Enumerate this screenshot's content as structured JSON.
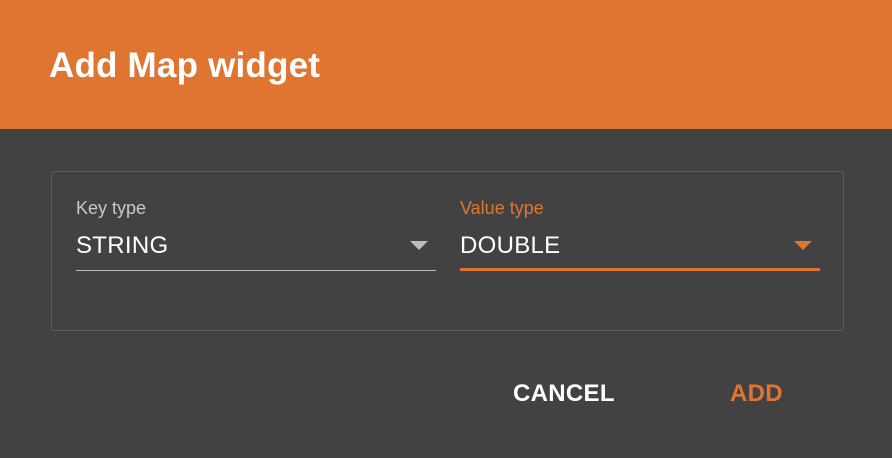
{
  "dialog": {
    "title": "Add Map widget",
    "header_color": "#e07532",
    "background_color": "#424242"
  },
  "fields": {
    "key_type": {
      "label": "Key type",
      "value": "STRING",
      "icon": "chevron-down-icon"
    },
    "value_type": {
      "label": "Value type",
      "value": "DOUBLE",
      "icon": "chevron-down-icon",
      "focused": true
    }
  },
  "actions": {
    "cancel_label": "CANCEL",
    "add_label": "ADD"
  },
  "colors": {
    "accent": "#e07532",
    "text": "#ffffff",
    "muted_label": "#c8c8c8"
  }
}
